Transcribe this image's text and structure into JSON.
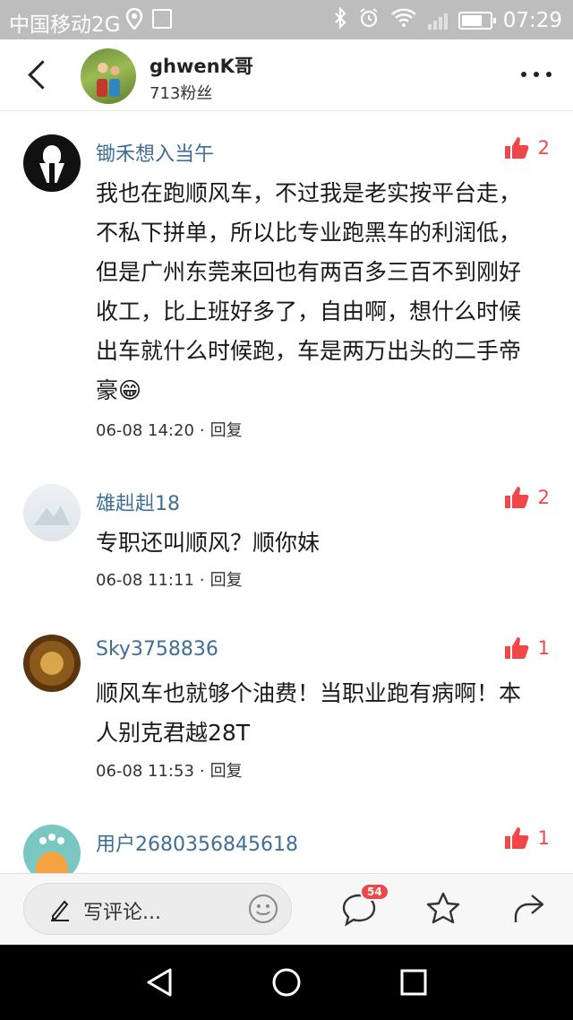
{
  "status_bar": {
    "carrier": "中国移动2G",
    "time": "07:29"
  },
  "header": {
    "author_name": "ghwenK哥",
    "author_fans": "713粉丝"
  },
  "comments": [
    {
      "user": "锄禾想入当午",
      "likes": "2",
      "text": "我也在跑顺风车，不过我是老实按平台走，不私下拼单，所以比专业跑黑车的利润低，但是广州东莞来回也有两百多三百不到刚好收工，比上班好多了，自由啊，想什么时候出车就什么时候跑，车是两万出头的二手帝豪😁",
      "time": "06-08 14:20",
      "reply_label": "回复"
    },
    {
      "user": "雄赳赳18",
      "likes": "2",
      "text": "专职还叫顺风？顺你妹",
      "time": "06-08 11:11",
      "reply_label": "回复"
    },
    {
      "user": "Sky3758836",
      "likes": "1",
      "text": "顺风车也就够个油费！当职业跑有病啊！本人别克君越28T",
      "time": "06-08 11:53",
      "reply_label": "回复"
    },
    {
      "user": "用户2680356845618",
      "likes": "1"
    }
  ],
  "bottom_bar": {
    "comment_placeholder": "写评论...",
    "comment_count_badge": "54"
  },
  "colors": {
    "username": "#3f6e98",
    "like": "#f0484a",
    "badge": "#f0484a"
  }
}
